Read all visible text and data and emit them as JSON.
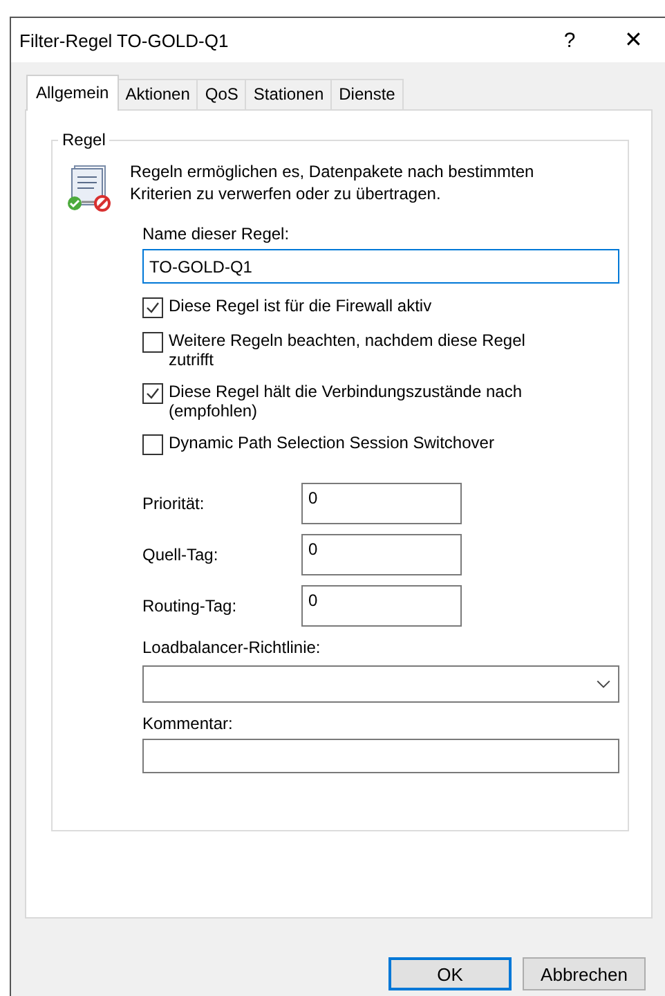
{
  "window": {
    "title": "Filter-Regel TO-GOLD-Q1",
    "help": "?",
    "close": "✕"
  },
  "tabs": [
    {
      "label": "Allgemein",
      "selected": true
    },
    {
      "label": "Aktionen",
      "selected": false
    },
    {
      "label": "QoS",
      "selected": false
    },
    {
      "label": "Stationen",
      "selected": false
    },
    {
      "label": "Dienste",
      "selected": false
    }
  ],
  "group": {
    "title": "Regel",
    "description": "Regeln ermöglichen es, Datenpakete nach bestimmten Kriterien zu verwerfen oder zu übertragen."
  },
  "name_field": {
    "label": "Name dieser Regel:",
    "value": "TO-GOLD-Q1",
    "focused": true
  },
  "checkboxes": [
    {
      "label": "Diese Regel ist für die Firewall aktiv",
      "checked": true
    },
    {
      "label": "Weitere Regeln beachten, nachdem diese Regel zutrifft",
      "checked": false
    },
    {
      "label": "Diese Regel hält die Verbindungszustände nach (empfohlen)",
      "checked": true
    },
    {
      "label": "Dynamic Path Selection Session Switchover",
      "checked": false
    }
  ],
  "numeric_fields": [
    {
      "label": "Priorität:",
      "value": "0"
    },
    {
      "label": "Quell-Tag:",
      "value": "0"
    },
    {
      "label": "Routing-Tag:",
      "value": "0"
    }
  ],
  "loadbalancer": {
    "label": "Loadbalancer-Richtlinie:"
  },
  "comment": {
    "label": "Kommentar:"
  },
  "buttons": [
    {
      "label": "OK",
      "default": true
    },
    {
      "label": "Abbrechen",
      "default": false
    }
  ]
}
